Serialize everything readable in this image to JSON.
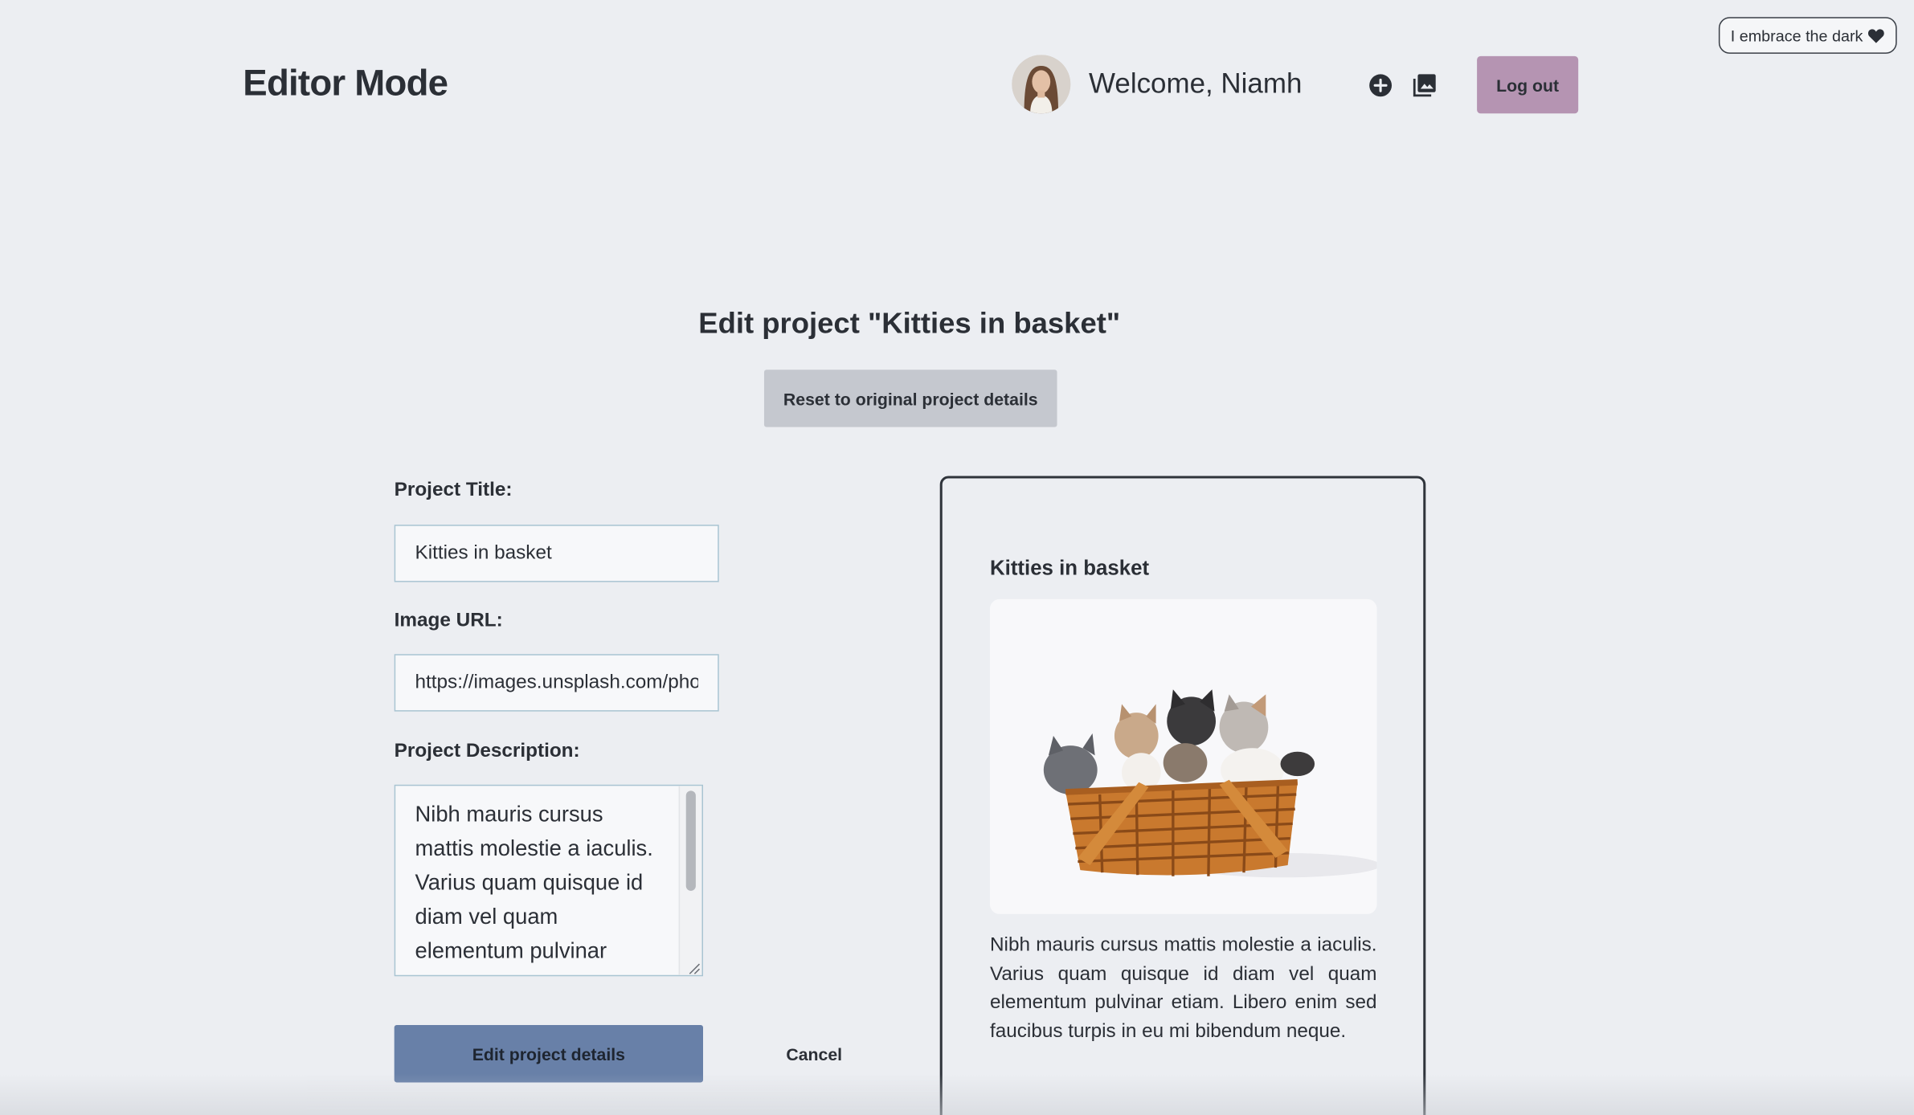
{
  "theme_toggle": {
    "label": "I embrace the dark",
    "icon": "black-heart-icon"
  },
  "header": {
    "brand": "Editor Mode",
    "welcome": "Welcome, Niamh",
    "add_icon": "add-circle-icon",
    "gallery_icon": "photo-library-icon",
    "logout_label": "Log out"
  },
  "main": {
    "title": "Edit project \"Kitties in basket\"",
    "reset_label": "Reset to original project details"
  },
  "form": {
    "title_label": "Project Title:",
    "title_value": "Kitties in basket",
    "url_label": "Image URL:",
    "url_value": "https://images.unsplash.com/pho",
    "description_label": "Project Description:",
    "description_value": "Nibh mauris cursus mattis molestie a iaculis. Varius quam quisque id diam vel quam elementum pulvinar etiam. Libero enim sed faucibus turpis in eu mi bibendum neque.",
    "submit_label": "Edit project details",
    "cancel_label": "Cancel"
  },
  "preview": {
    "title": "Kitties in basket",
    "description": "Nibh mauris cursus mattis molestie a iaculis. Varius quam quisque id diam vel quam elementum pulvinar etiam. Libero enim sed faucibus turpis in eu mi bibendum neque."
  },
  "colors": {
    "background": "#eceef2",
    "logout": "#b594b2",
    "submit": "#6880a8",
    "reset": "#c5c8cf",
    "text": "#2b2f36"
  }
}
